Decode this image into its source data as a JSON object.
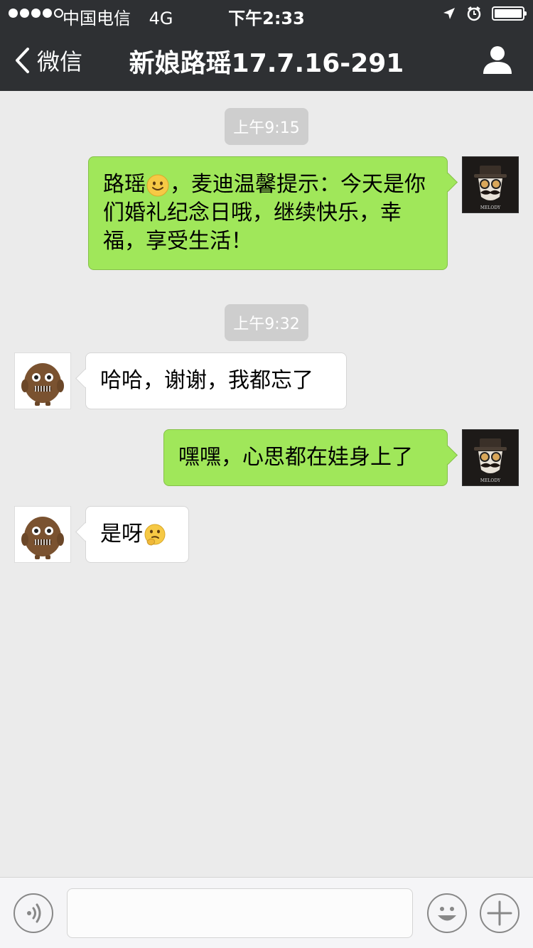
{
  "status_bar": {
    "carrier": "中国电信",
    "network": "4G",
    "time": "下午2:33",
    "battery_level": 1.0,
    "icons": [
      "signal-dots-icon",
      "location-arrow-icon",
      "alarm-clock-icon",
      "battery-icon"
    ]
  },
  "nav": {
    "back_label": "微信",
    "title": "新娘路瑶17.7.16-291",
    "right_icon": "person-icon"
  },
  "messages": [
    {
      "type": "time",
      "text": "上午9:15"
    },
    {
      "type": "sent",
      "sender_avatar": "melody-avatar",
      "text_before_emoji": "路瑶",
      "emoji": "smile-emoji",
      "text_after_emoji": "，麦迪温馨提示：今天是你们婚礼纪念日哦，继续快乐，幸福，享受生活！"
    },
    {
      "type": "time",
      "text": "上午9:32"
    },
    {
      "type": "received",
      "sender_avatar": "monster-avatar",
      "text": "哈哈，谢谢，我都忘了"
    },
    {
      "type": "sent",
      "sender_avatar": "melody-avatar",
      "text": "嘿嘿，心思都在娃身上了"
    },
    {
      "type": "received",
      "sender_avatar": "monster-avatar",
      "text": "是呀",
      "emoji": "thinking-emoji"
    }
  ],
  "input_bar": {
    "placeholder": "",
    "voice_icon": "voice-icon",
    "emoji_icon": "emoji-face-icon",
    "plus_icon": "plus-icon"
  },
  "colors": {
    "nav_bg": "#2e3033",
    "chat_bg": "#ebebeb",
    "sent_bubble": "#a0e75a",
    "received_bubble": "#ffffff",
    "time_badge": "#cecece"
  }
}
